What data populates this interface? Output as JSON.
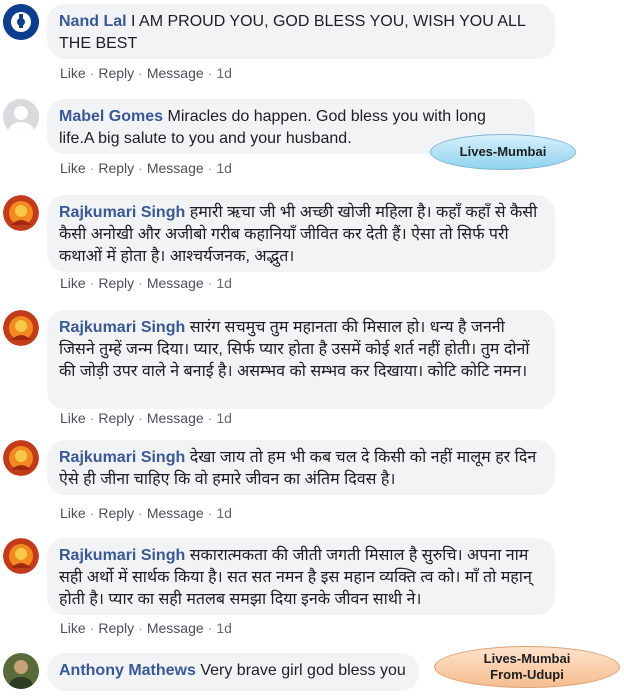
{
  "comments": [
    {
      "author": "Nand Lal",
      "text": "I AM PROUD YOU, GOD BLESS YOU, WISH YOU ALL THE BEST",
      "actions": {
        "like": "Like",
        "reply": "Reply",
        "message": "Message",
        "time": "1d"
      },
      "avatar": "bank-logo-icon"
    },
    {
      "author": "Mabel Gomes",
      "text": "Miracles do happen. God bless you with long life.A big salute to you and your husband.",
      "actions": {
        "like": "Like",
        "reply": "Reply",
        "message": "Message",
        "time": "1d"
      },
      "avatar": "default-user-icon"
    },
    {
      "author": "Rajkumari Singh",
      "text": "हमारी ऋचा जी भी अच्छी खोजी महिला है। कहाँ कहाँ से कैसी कैसी अनोखी और अजीबो गरीब कहानियाँ जीवित कर देती हैं। ऐसा तो सिर्फ परी कथाओं में होता है। आश्चर्यजनक, अद्भुत।",
      "actions": {
        "like": "Like",
        "reply": "Reply",
        "message": "Message",
        "time": "1d"
      },
      "avatar": "deity-icon"
    },
    {
      "author": "Rajkumari Singh",
      "text": "सारंग सचमुच तुम महानता की मिसाल हो। धन्य है जननी जिसने तुम्हें जन्म दिया। प्यार, सिर्फ प्यार होता है उसमें कोई शर्त नहीं होती। तुम दोनों की जोड़ी उपर वाले ने बनाई है। असम्भव को सम्भव कर दिखाया। कोटि कोटि नमन।",
      "actions": {
        "like": "Like",
        "reply": "Reply",
        "message": "Message",
        "time": "1d"
      },
      "avatar": "deity-icon"
    },
    {
      "author": "Rajkumari Singh",
      "text": "देखा जाय तो हम भी कब चल दे किसी को नहीं मालूम हर दिन ऐसे ही जीना चाहिए कि वो हमारे जीवन का अंतिम दिवस है।",
      "actions": {
        "like": "Like",
        "reply": "Reply",
        "message": "Message",
        "time": "1d"
      },
      "avatar": "deity-icon"
    },
    {
      "author": "Rajkumari Singh",
      "text": "सकारात्मकता की जीती जगती मिसाल है सुरुचि। अपना नाम सही अर्थो में सार्थक किया है। सत सत नमन है इस महान व्यक्ति त्व को। माँ तो महान् होती है। प्यार का सही मतलब समझा दिया इनके जीवन साथी ने।",
      "actions": {
        "like": "Like",
        "reply": "Reply",
        "message": "Message",
        "time": "1d"
      },
      "avatar": "deity-icon"
    },
    {
      "author": "Anthony Mathews",
      "text": "Very brave girl god bless you",
      "avatar": "user-photo-icon"
    }
  ],
  "tags": {
    "tag1": "Lives-Mumbai",
    "tag2_line1": "Lives-Mumbai",
    "tag2_line2": "From-Udupi"
  },
  "colors": {
    "author": "#385898",
    "bubble": "#f2f3f5",
    "actions": "#606770"
  }
}
